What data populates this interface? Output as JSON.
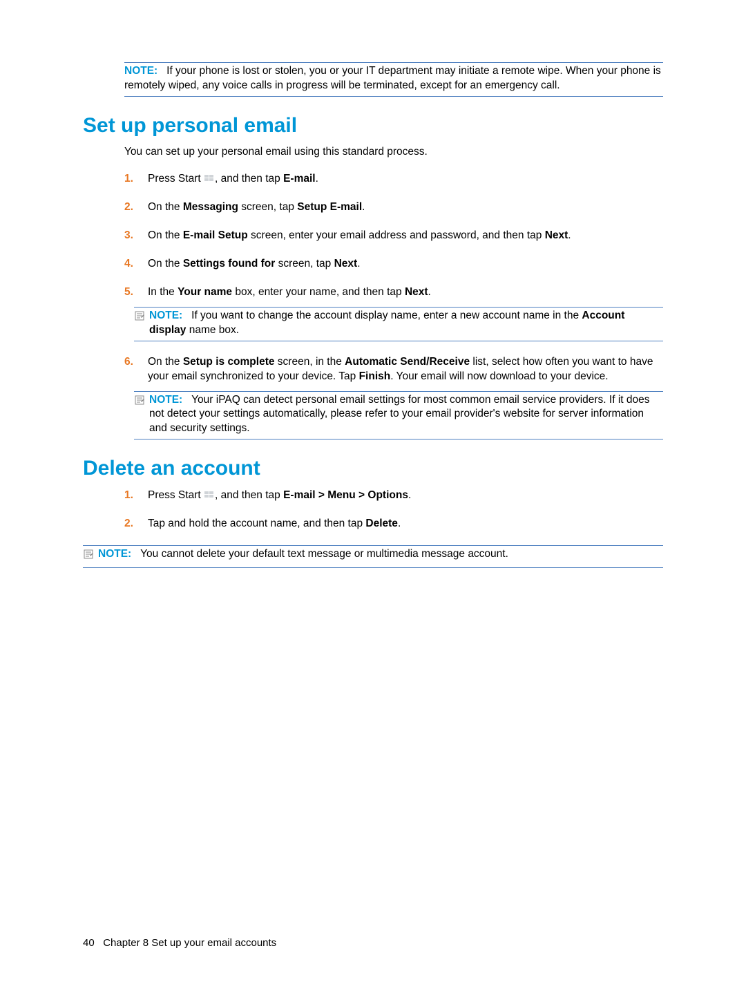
{
  "noteLabel": "NOTE:",
  "topNote": "If your phone is lost or stolen, you or your IT department may initiate a remote wipe. When your phone is remotely wiped, any voice calls in progress will be terminated, except for an emergency call.",
  "section1": {
    "heading": "Set up personal email",
    "intro": "You can set up your personal email using this standard process.",
    "steps": {
      "s1": {
        "num": "1.",
        "pre": "Press Start ",
        "post": ", and then tap ",
        "bold": "E-mail",
        "end": "."
      },
      "s2": {
        "num": "2.",
        "a": "On the ",
        "b1": "Messaging",
        "c": " screen, tap ",
        "b2": "Setup E-mail",
        "end": "."
      },
      "s3": {
        "num": "3.",
        "a": "On the ",
        "b1": "E-mail Setup",
        "c": " screen, enter your email address and password, and then tap ",
        "b2": "Next",
        "end": "."
      },
      "s4": {
        "num": "4.",
        "a": "On the ",
        "b1": "Settings found for",
        "c": " screen, tap ",
        "b2": "Next",
        "end": "."
      },
      "s5": {
        "num": "5.",
        "a": "In the ",
        "b1": "Your name",
        "c": " box, enter your name, and then tap ",
        "b2": "Next",
        "end": "."
      },
      "note5": {
        "a": "If you want to change the account display name, enter a new account name in the ",
        "b": "Account display",
        "c": " name box."
      },
      "s6": {
        "num": "6.",
        "a": "On the ",
        "b1": "Setup is complete",
        "c": " screen, in the ",
        "b2": "Automatic Send/Receive",
        "d": " list, select how often you want to have your email synchronized to your device. Tap ",
        "b3": "Finish",
        "e": ". Your email will now download to your device."
      },
      "note6": "Your iPAQ can detect personal email settings for most common email service providers. If it does not detect your settings automatically, please refer to your email provider's website for server information and security settings."
    }
  },
  "section2": {
    "heading": "Delete an account",
    "steps": {
      "s1": {
        "num": "1.",
        "pre": "Press Start ",
        "post": ", and then tap ",
        "bold": "E-mail > Menu > Options",
        "end": "."
      },
      "s2": {
        "num": "2.",
        "a": "Tap and hold the account name, and then tap ",
        "b": "Delete",
        "end": "."
      }
    },
    "finalNote": "You cannot delete your default text message or multimedia message account."
  },
  "footer": {
    "page": "40",
    "chapter": "Chapter 8   Set up your email accounts"
  }
}
